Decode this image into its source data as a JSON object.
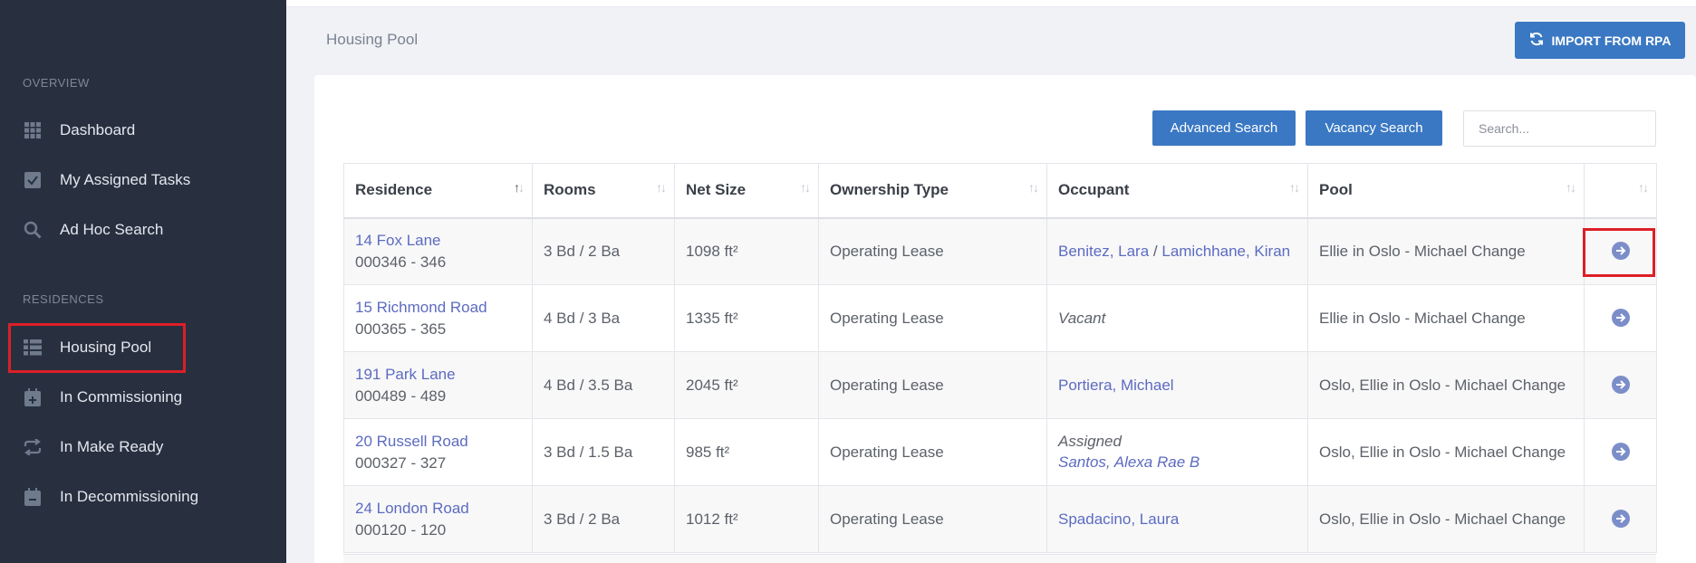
{
  "sidebar": {
    "overview_label": "OVERVIEW",
    "overview_items": [
      {
        "label": "Dashboard",
        "icon": "grid-icon"
      },
      {
        "label": "My Assigned Tasks",
        "icon": "checkbox-icon"
      },
      {
        "label": "Ad Hoc Search",
        "icon": "search-icon"
      }
    ],
    "residences_label": "RESIDENCES",
    "residences_items": [
      {
        "label": "Housing Pool",
        "icon": "list-icon",
        "highlighted": true
      },
      {
        "label": "In Commissioning",
        "icon": "calendar-plus-icon"
      },
      {
        "label": "In Make Ready",
        "icon": "repeat-icon"
      },
      {
        "label": "In Decommissioning",
        "icon": "calendar-minus-icon"
      }
    ]
  },
  "header": {
    "page_title": "Housing Pool",
    "import_label": "IMPORT FROM RPA"
  },
  "toolbar": {
    "advanced_search": "Advanced Search",
    "vacancy_search": "Vacancy Search",
    "search_placeholder": "Search..."
  },
  "table": {
    "columns": [
      "Residence",
      "Rooms",
      "Net Size",
      "Ownership Type",
      "Occupant",
      "Pool",
      ""
    ],
    "rows": [
      {
        "residence": "14 Fox Lane",
        "code": "000346 - 346",
        "rooms": "3 Bd / 2 Ba",
        "size": "1098 ft²",
        "ownership": "Operating Lease",
        "occupant_a": "Benitez, Lara",
        "occupant_sep": " / ",
        "occupant_b": "Lamichhane, Kiran",
        "pool": "Ellie in Oslo - Michael Change"
      },
      {
        "residence": "15 Richmond Road",
        "code": "000365 - 365",
        "rooms": "4 Bd / 3 Ba",
        "size": "1335 ft²",
        "ownership": "Operating Lease",
        "occupant_status": "Vacant",
        "pool": "Ellie in Oslo - Michael Change"
      },
      {
        "residence": "191 Park Lane",
        "code": "000489 - 489",
        "rooms": "4 Bd / 3.5 Ba",
        "size": "2045 ft²",
        "ownership": "Operating Lease",
        "occupant_a": "Portiera, Michael",
        "pool": "Oslo, Ellie in Oslo - Michael Change"
      },
      {
        "residence": "20 Russell Road",
        "code": "000327 - 327",
        "rooms": "3 Bd / 1.5 Ba",
        "size": "985 ft²",
        "ownership": "Operating Lease",
        "occupant_status": "Assigned",
        "occupant_b": "Santos, Alexa Rae B",
        "pool": "Oslo, Ellie in Oslo - Michael Change"
      },
      {
        "residence": "24 London Road",
        "code": "000120 - 120",
        "rooms": "3 Bd / 2 Ba",
        "size": "1012 ft²",
        "ownership": "Operating Lease",
        "occupant_a": "Spadacino, Laura",
        "pool": "Oslo, Ellie in Oslo - Michael Change"
      }
    ]
  },
  "colors": {
    "sidebar_bg": "#283040",
    "accent_blue": "#3a78c3",
    "link": "#5c6bc0",
    "highlight_red": "#dc1f26"
  }
}
